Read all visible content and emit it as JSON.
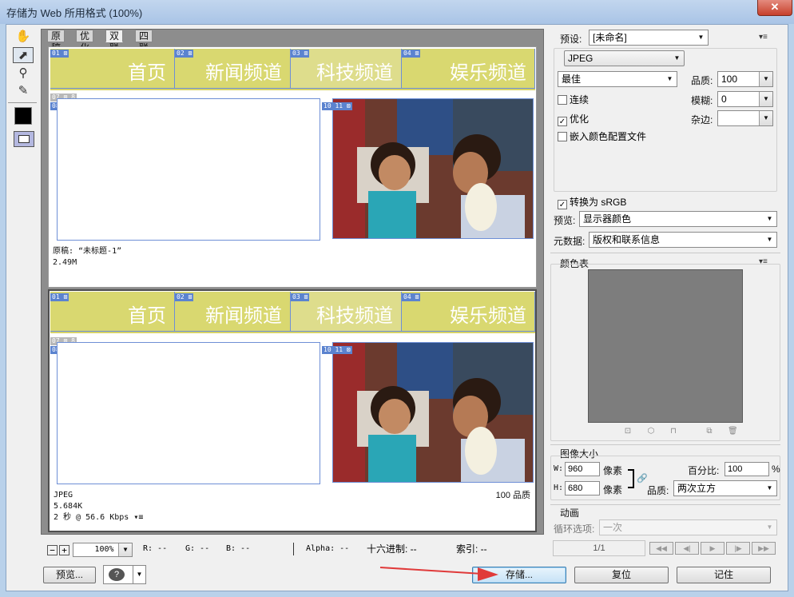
{
  "window": {
    "title": "存储为 Web 所用格式 (100%)",
    "close": "✕"
  },
  "tools": [
    {
      "name": "hand-tool-icon",
      "glyph": "✋"
    },
    {
      "name": "slice-select-tool-icon",
      "glyph": "⬈"
    },
    {
      "name": "zoom-tool-icon",
      "glyph": "🔍"
    },
    {
      "name": "eyedropper-tool-icon",
      "glyph": "⁄"
    }
  ],
  "tabs": [
    "原稿",
    "优化",
    "双联",
    "四联"
  ],
  "nav_items": [
    {
      "num": "01",
      "label": "首页"
    },
    {
      "num": "02",
      "label": "新闻频道"
    },
    {
      "num": "03",
      "label": "科技频道"
    },
    {
      "num": "04",
      "label": "娱乐频道"
    }
  ],
  "slice_numbers": {
    "s07": "07",
    "s08": "08",
    "s09": "09",
    "s10": "10",
    "s11": "11"
  },
  "top_pane": {
    "line1": "原稿: “未标题-1”",
    "line2": "2.49M"
  },
  "bottom_pane": {
    "format": "JPEG",
    "size": "5.684K",
    "time": "2 秒 @ 56.6 Kbps",
    "quality": "100 品质"
  },
  "status": {
    "zoom": "100%",
    "r": "R: --",
    "g": "G: --",
    "b": "B: --",
    "alpha": "Alpha: --",
    "hex": "十六进制: --",
    "index": "索引: --"
  },
  "buttons": {
    "preview": "预览...",
    "save": "存储...",
    "reset": "复位",
    "remember": "记住"
  },
  "right": {
    "preset_label": "预设:",
    "preset_value": "[未命名]",
    "format": "JPEG",
    "quality_mode": "最佳",
    "quality_label": "品质:",
    "quality_value": "100",
    "blur_label": "模糊:",
    "blur_value": "0",
    "matte_label": "杂边:",
    "progressive": "连续",
    "optimized": "优化",
    "embed_profile": "嵌入颜色配置文件",
    "convert_srgb": "转换为 sRGB",
    "preview_label": "预览:",
    "preview_value": "显示器颜色",
    "metadata_label": "元数据:",
    "metadata_value": "版权和联系信息",
    "color_table_label": "颜色表",
    "image_size_label": "图像大小",
    "w_label": "W:",
    "w_value": "960",
    "h_label": "H:",
    "h_value": "680",
    "pixels": "像素",
    "percent_label": "百分比:",
    "percent_value": "100",
    "percent_unit": "%",
    "resample_label": "品质:",
    "resample_value": "两次立方",
    "animation_label": "动画",
    "loop_label": "循环选项:",
    "loop_value": "一次",
    "frame": "1/1"
  },
  "colors": {
    "nav_bg": "#d9d870",
    "slice_blue": "#5b83cf",
    "arrow_red": "#e03a3a"
  }
}
